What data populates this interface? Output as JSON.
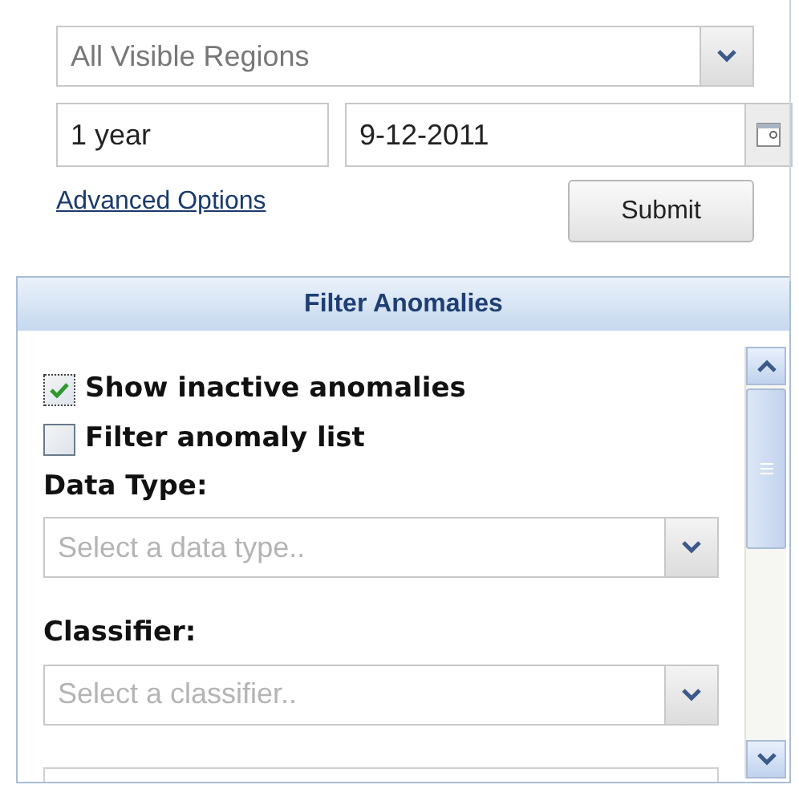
{
  "region_select": {
    "value": "All Visible Regions"
  },
  "duration_field": {
    "value": "1 year"
  },
  "date_field": {
    "value": "9-12-2011"
  },
  "advanced_link": "Advanced Options",
  "submit_button": "Submit",
  "panel": {
    "title": "Filter Anomalies",
    "checkboxes": [
      {
        "label": "Show inactive anomalies",
        "checked": true
      },
      {
        "label": "Filter anomaly list",
        "checked": false
      }
    ],
    "fields": [
      {
        "label": "Data Type:",
        "placeholder": "Select a data type.."
      },
      {
        "label": "Classifier:",
        "placeholder": "Select a classifier.."
      }
    ]
  }
}
